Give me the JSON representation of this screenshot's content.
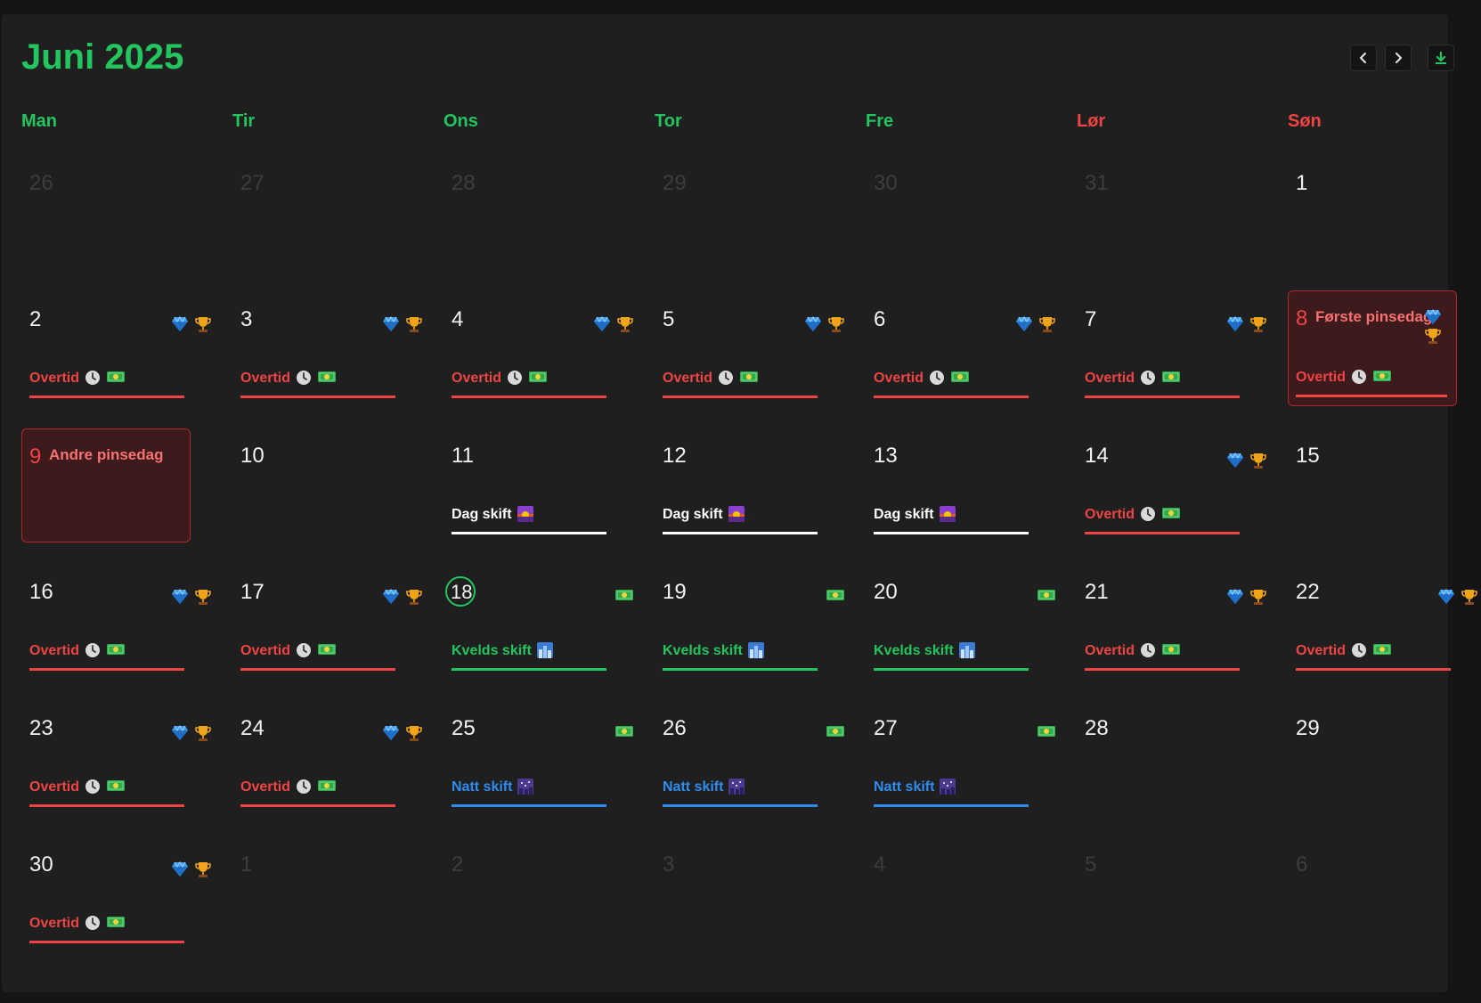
{
  "header": {
    "title": "Juni 2025",
    "prev_icon": "chevron-left-icon",
    "next_icon": "chevron-right-icon",
    "download_icon": "download-icon"
  },
  "colors": {
    "accent": "#22c55e",
    "weekend": "#ef4444",
    "overtid": "#ef4444",
    "dag": "#ffffff",
    "kveld": "#22c55e",
    "natt": "#2f8cf0",
    "holiday_bg": "#3d1a1c"
  },
  "weekdays": [
    {
      "label": "Man",
      "weekend": false
    },
    {
      "label": "Tir",
      "weekend": false
    },
    {
      "label": "Ons",
      "weekend": false
    },
    {
      "label": "Tor",
      "weekend": false
    },
    {
      "label": "Fre",
      "weekend": false
    },
    {
      "label": "Lør",
      "weekend": true
    },
    {
      "label": "Søn",
      "weekend": true
    }
  ],
  "shift_labels": {
    "overtid": "Overtid",
    "dag": "Dag skift",
    "kveld": "Kvelds skift",
    "natt": "Natt skift"
  },
  "days": [
    {
      "n": "26",
      "other": true
    },
    {
      "n": "27",
      "other": true
    },
    {
      "n": "28",
      "other": true
    },
    {
      "n": "29",
      "other": true
    },
    {
      "n": "30",
      "other": true
    },
    {
      "n": "31",
      "other": true
    },
    {
      "n": "1"
    },
    {
      "n": "2",
      "badges": [
        "gem",
        "cup"
      ],
      "shift": "overtid"
    },
    {
      "n": "3",
      "badges": [
        "gem",
        "cup"
      ],
      "shift": "overtid"
    },
    {
      "n": "4",
      "badges": [
        "gem",
        "cup"
      ],
      "shift": "overtid"
    },
    {
      "n": "5",
      "badges": [
        "gem",
        "cup"
      ],
      "shift": "overtid"
    },
    {
      "n": "6",
      "badges": [
        "gem",
        "cup"
      ],
      "shift": "overtid"
    },
    {
      "n": "7",
      "badges": [
        "gem",
        "cup"
      ],
      "shift": "overtid"
    },
    {
      "n": "8",
      "holiday": "Første pinsedag",
      "badges": [
        "gem",
        "cup"
      ],
      "shift": "overtid"
    },
    {
      "n": "9",
      "holiday": "Andre pinsedag"
    },
    {
      "n": "10"
    },
    {
      "n": "11",
      "shift": "dag"
    },
    {
      "n": "12",
      "shift": "dag"
    },
    {
      "n": "13",
      "shift": "dag"
    },
    {
      "n": "14",
      "badges": [
        "gem",
        "cup"
      ],
      "shift": "overtid"
    },
    {
      "n": "15"
    },
    {
      "n": "16",
      "badges": [
        "gem",
        "cup"
      ],
      "shift": "overtid"
    },
    {
      "n": "17",
      "badges": [
        "gem",
        "cup"
      ],
      "shift": "overtid"
    },
    {
      "n": "18",
      "today": true,
      "badges": [
        "cash"
      ],
      "shift": "kveld"
    },
    {
      "n": "19",
      "badges": [
        "cash"
      ],
      "shift": "kveld"
    },
    {
      "n": "20",
      "badges": [
        "cash"
      ],
      "shift": "kveld"
    },
    {
      "n": "21",
      "badges": [
        "gem",
        "cup"
      ],
      "shift": "overtid"
    },
    {
      "n": "22",
      "badges": [
        "gem",
        "cup"
      ],
      "shift": "overtid"
    },
    {
      "n": "23",
      "badges": [
        "gem",
        "cup"
      ],
      "shift": "overtid"
    },
    {
      "n": "24",
      "badges": [
        "gem",
        "cup"
      ],
      "shift": "overtid"
    },
    {
      "n": "25",
      "badges": [
        "cash"
      ],
      "shift": "natt"
    },
    {
      "n": "26",
      "badges": [
        "cash"
      ],
      "shift": "natt"
    },
    {
      "n": "27",
      "badges": [
        "cash"
      ],
      "shift": "natt"
    },
    {
      "n": "28"
    },
    {
      "n": "29"
    },
    {
      "n": "30",
      "badges": [
        "gem",
        "cup"
      ],
      "shift": "overtid"
    },
    {
      "n": "1",
      "other": true
    },
    {
      "n": "2",
      "other": true
    },
    {
      "n": "3",
      "other": true
    },
    {
      "n": "4",
      "other": true
    },
    {
      "n": "5",
      "other": true
    },
    {
      "n": "6",
      "other": true
    }
  ]
}
